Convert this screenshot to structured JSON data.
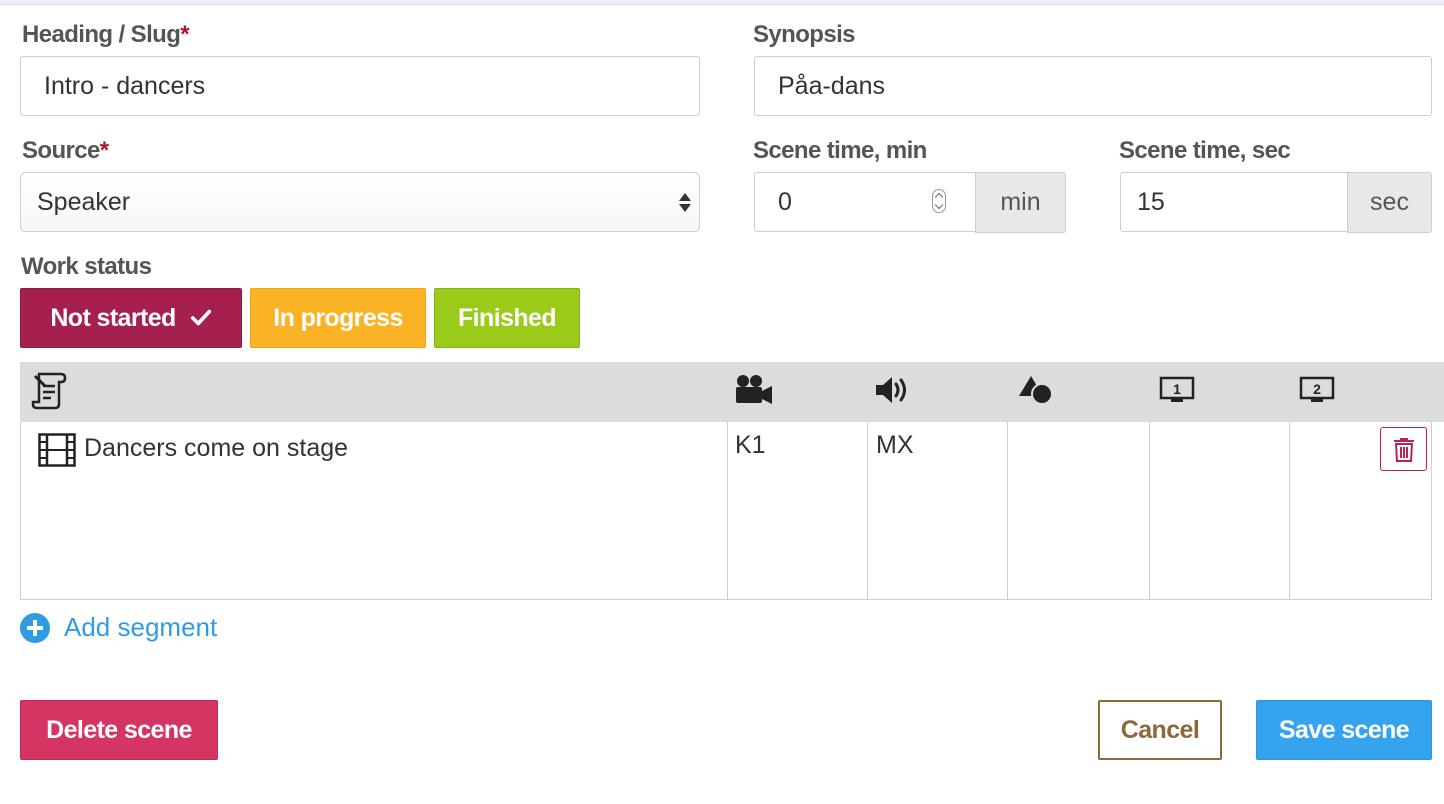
{
  "form": {
    "heading": {
      "label": "Heading / Slug",
      "required_mark": "*",
      "value": "Intro - dancers"
    },
    "synopsis": {
      "label": "Synopsis",
      "value": "Påa-dans"
    },
    "source": {
      "label": "Source",
      "required_mark": "*",
      "selected": "Speaker"
    },
    "scene_time_min": {
      "label": "Scene time, min",
      "value": "0",
      "unit": "min"
    },
    "scene_time_sec": {
      "label": "Scene time, sec",
      "value": "15",
      "unit": "sec"
    }
  },
  "work_status": {
    "label": "Work status",
    "options": [
      {
        "label": "Not started",
        "selected": true,
        "color": "#a5204e"
      },
      {
        "label": "In progress",
        "selected": false,
        "color": "#fbb326"
      },
      {
        "label": "Finished",
        "selected": false,
        "color": "#9bcb1a"
      }
    ]
  },
  "segments": {
    "columns": [
      {
        "icon": "script-icon"
      },
      {
        "icon": "camera-icon"
      },
      {
        "icon": "speaker-icon"
      },
      {
        "icon": "shapes-icon"
      },
      {
        "icon": "screen-1-icon",
        "text": "1"
      },
      {
        "icon": "screen-2-icon",
        "text": "2"
      }
    ],
    "rows": [
      {
        "icon": "film-icon",
        "text": "Dancers come on stage",
        "camera": "K1",
        "audio": "MX",
        "graphics": "",
        "screen1": "",
        "screen2": ""
      }
    ]
  },
  "actions": {
    "add_segment": "Add segment",
    "delete_scene": "Delete scene",
    "cancel": "Cancel",
    "save_scene": "Save scene"
  },
  "colors": {
    "accent_blue": "#36a3ee",
    "delete_red": "#d53562",
    "cancel_brown": "#8b6a3a"
  }
}
